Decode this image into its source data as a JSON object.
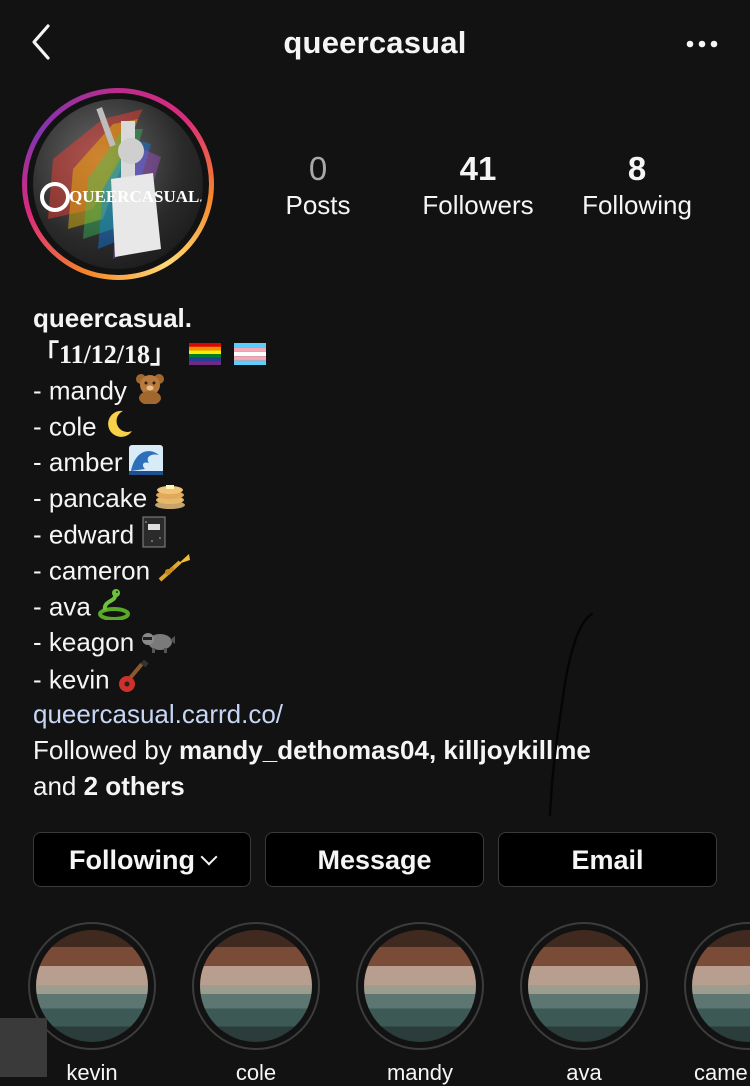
{
  "header": {
    "title": "queercasual",
    "back_icon": "chevron-left-icon",
    "more_icon": "ellipsis-icon"
  },
  "avatar": {
    "logo_text": "QUEERCASUAL."
  },
  "stats": [
    {
      "value": "0",
      "label": "Posts"
    },
    {
      "value": "41",
      "label": "Followers"
    },
    {
      "value": "8",
      "label": "Following"
    }
  ],
  "bio": {
    "name": "queercasual.",
    "date": "「11/12/18」",
    "members": [
      {
        "text": "- mandy",
        "icon": "teddy-bear-icon"
      },
      {
        "text": "- cole",
        "icon": "crescent-moon-icon"
      },
      {
        "text": "- amber",
        "icon": "wave-icon"
      },
      {
        "text": "- pancake",
        "icon": "pancakes-icon"
      },
      {
        "text": "- edward",
        "icon": "notebook-icon"
      },
      {
        "text": "- cameron",
        "icon": "trumpet-icon"
      },
      {
        "text": "- ava",
        "icon": "snake-icon"
      },
      {
        "text": "- keagon",
        "icon": "raccoon-icon"
      },
      {
        "text": "- kevin",
        "icon": "guitar-icon"
      }
    ],
    "link": "queercasual.carrd.co/",
    "followed_prefix": "Followed by",
    "followed_users": "mandy_dethomas04, killjoykillme",
    "followed_and": "and",
    "followed_others": "2 others"
  },
  "buttons": {
    "following": "Following",
    "message": "Message",
    "email": "Email"
  },
  "highlights": [
    {
      "label": "kevin"
    },
    {
      "label": "cole"
    },
    {
      "label": "mandy"
    },
    {
      "label": "ava"
    },
    {
      "label": "came"
    }
  ],
  "colors": {
    "background": "#121212",
    "link": "#c7d6f5",
    "button_border": "#3a3a3a"
  }
}
